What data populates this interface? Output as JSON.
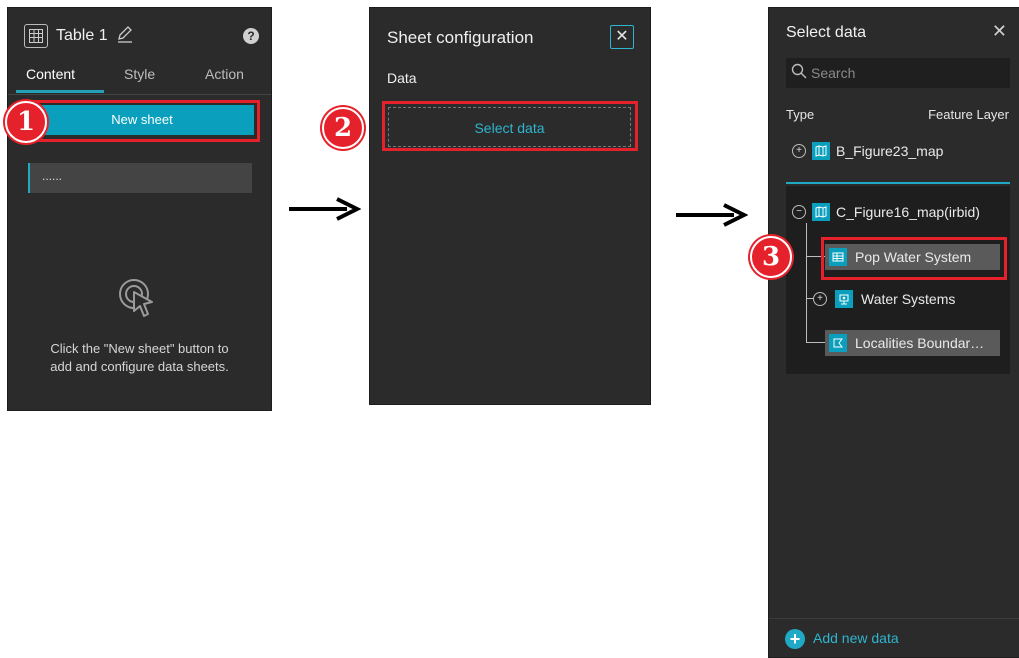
{
  "panel1": {
    "title": "Table 1",
    "help_glyph": "?",
    "tabs": [
      "Content",
      "Style",
      "Action"
    ],
    "new_sheet_label": "New sheet",
    "sheet_placeholder": "......",
    "empty_text_line1": "Click the \"New sheet\" button to",
    "empty_text_line2": "add and configure data sheets.",
    "icons": [
      "table-icon",
      "edit-pencil-icon",
      "help-icon",
      "click-pointer-icon"
    ]
  },
  "panel2": {
    "title": "Sheet configuration",
    "close_glyph": "✕",
    "section_label": "Data",
    "select_data_label": "Select data"
  },
  "panel3": {
    "title": "Select data",
    "close_glyph": "✕",
    "search_placeholder": "Search",
    "type_label": "Type",
    "type_value": "Feature Layer",
    "maps": [
      {
        "name": "B_Figure23_map",
        "expanded": false
      },
      {
        "name": "C_Figure16_map(irbid)",
        "expanded": true
      }
    ],
    "layers": [
      "Pop Water System",
      "Water Systems",
      "Localities Boundar…"
    ],
    "add_new_data_label": "Add new data"
  },
  "steps": {
    "step1": "1",
    "step2": "2",
    "step3": "3"
  },
  "colors": {
    "accent": "#0a9fbd",
    "highlight_red": "#e5222b",
    "panel_bg": "#2b2b2b"
  }
}
